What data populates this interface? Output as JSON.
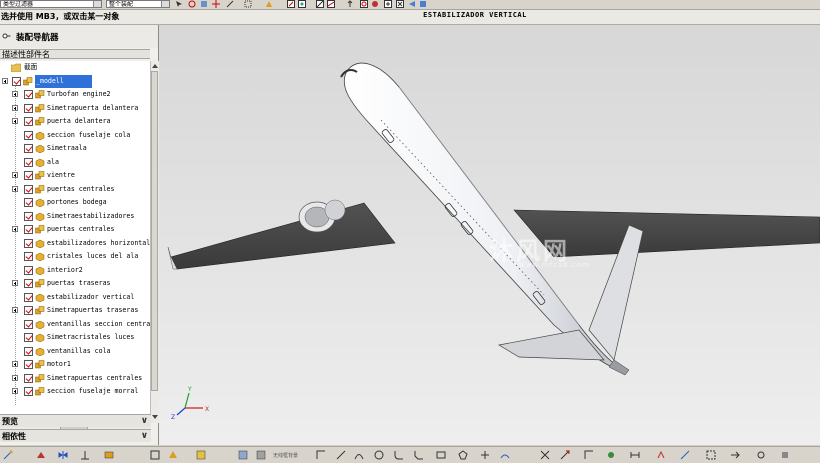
{
  "toolbar_top": {
    "filter_combo": "类型过滤器",
    "assembly_combo": "整个装配"
  },
  "status": {
    "prompt": "选并使用 MB3，或双击某一对象",
    "part_title": "ESTABILIZADOR VERTICAL"
  },
  "navigator": {
    "title": "装配导航器",
    "column_header": "描述性部件名",
    "root_label": "截面",
    "items": [
      {
        "label": "_modell",
        "selected": true,
        "expandable": false
      },
      {
        "label": "Turbofan engine2",
        "expandable": true
      },
      {
        "label": "Simetrapuerta delantera",
        "expandable": true
      },
      {
        "label": "puerta delantera",
        "expandable": true
      },
      {
        "label": "seccion fuselaje cola",
        "expandable": false
      },
      {
        "label": "Simetraala",
        "expandable": false
      },
      {
        "label": "ala",
        "expandable": false
      },
      {
        "label": "vientre",
        "expandable": true
      },
      {
        "label": "puertas centrales",
        "expandable": true
      },
      {
        "label": "portones bodega",
        "expandable": false
      },
      {
        "label": "Simetraestabilizadores",
        "expandable": false
      },
      {
        "label": "puertas centrales",
        "expandable": true
      },
      {
        "label": "estabilizadores horizontales",
        "expandable": false
      },
      {
        "label": "cristales luces del ala",
        "expandable": false
      },
      {
        "label": "interior2",
        "expandable": false
      },
      {
        "label": "puertas traseras",
        "expandable": true
      },
      {
        "label": "estabilizador vertical",
        "expandable": false
      },
      {
        "label": "Simetrapuertas traseras",
        "expandable": true
      },
      {
        "label": "ventanillas seccion central",
        "expandable": false
      },
      {
        "label": "Simetracristales luces",
        "expandable": false
      },
      {
        "label": "ventanillas cola",
        "expandable": false
      },
      {
        "label": "motor1",
        "expandable": true
      },
      {
        "label": "Simetrapuertas centrales",
        "expandable": true
      },
      {
        "label": "seccion fuselaje morral",
        "expandable": true
      }
    ],
    "preview_label": "预览",
    "dependency_label": "相依性"
  },
  "viewport": {
    "watermark": "沐风网",
    "watermark_sub": "www.mfcad.com",
    "axis": {
      "x": "X",
      "y": "Y",
      "z": "Z"
    }
  },
  "toolbar_bottom": {
    "render_mode": "无线框背景"
  },
  "colors": {
    "selection": "#2f71d9",
    "check": "#dd0000",
    "axis_x": "#d22020",
    "axis_y": "#20a020",
    "axis_z": "#2040d0"
  }
}
